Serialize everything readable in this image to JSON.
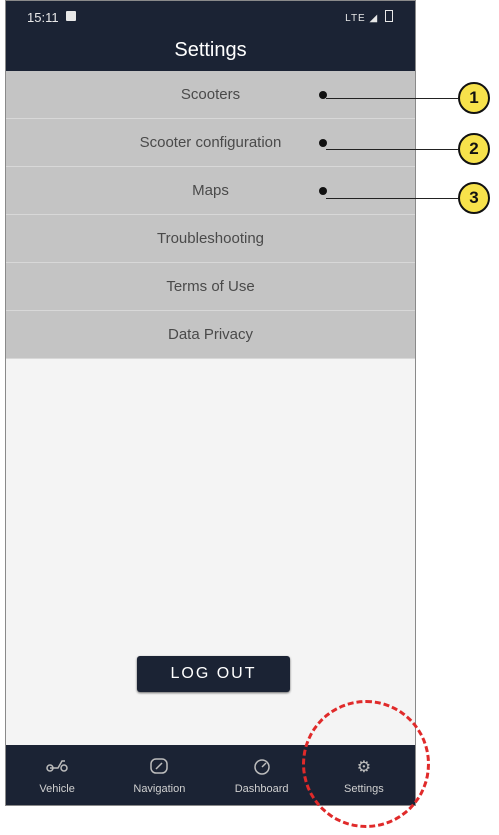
{
  "status_bar": {
    "time": "15:11",
    "network": "LTE"
  },
  "header": {
    "title": "Settings"
  },
  "menu": {
    "items": [
      {
        "label": "Scooters"
      },
      {
        "label": "Scooter configuration"
      },
      {
        "label": "Maps"
      },
      {
        "label": "Troubleshooting"
      },
      {
        "label": "Terms of Use"
      },
      {
        "label": "Data Privacy"
      }
    ]
  },
  "logout": {
    "label": "LOG OUT"
  },
  "bottom_nav": {
    "tabs": [
      {
        "label": "Vehicle",
        "icon": "scooter-icon"
      },
      {
        "label": "Navigation",
        "icon": "navigation-icon"
      },
      {
        "label": "Dashboard",
        "icon": "speedometer-icon"
      },
      {
        "label": "Settings",
        "icon": "gear-icon"
      }
    ]
  },
  "callouts": [
    "1",
    "2",
    "3"
  ],
  "colors": {
    "bar": "#1b2334",
    "menu": "#c4c4c4",
    "callout": "#f7e24b",
    "highlight": "#e02a2a"
  }
}
